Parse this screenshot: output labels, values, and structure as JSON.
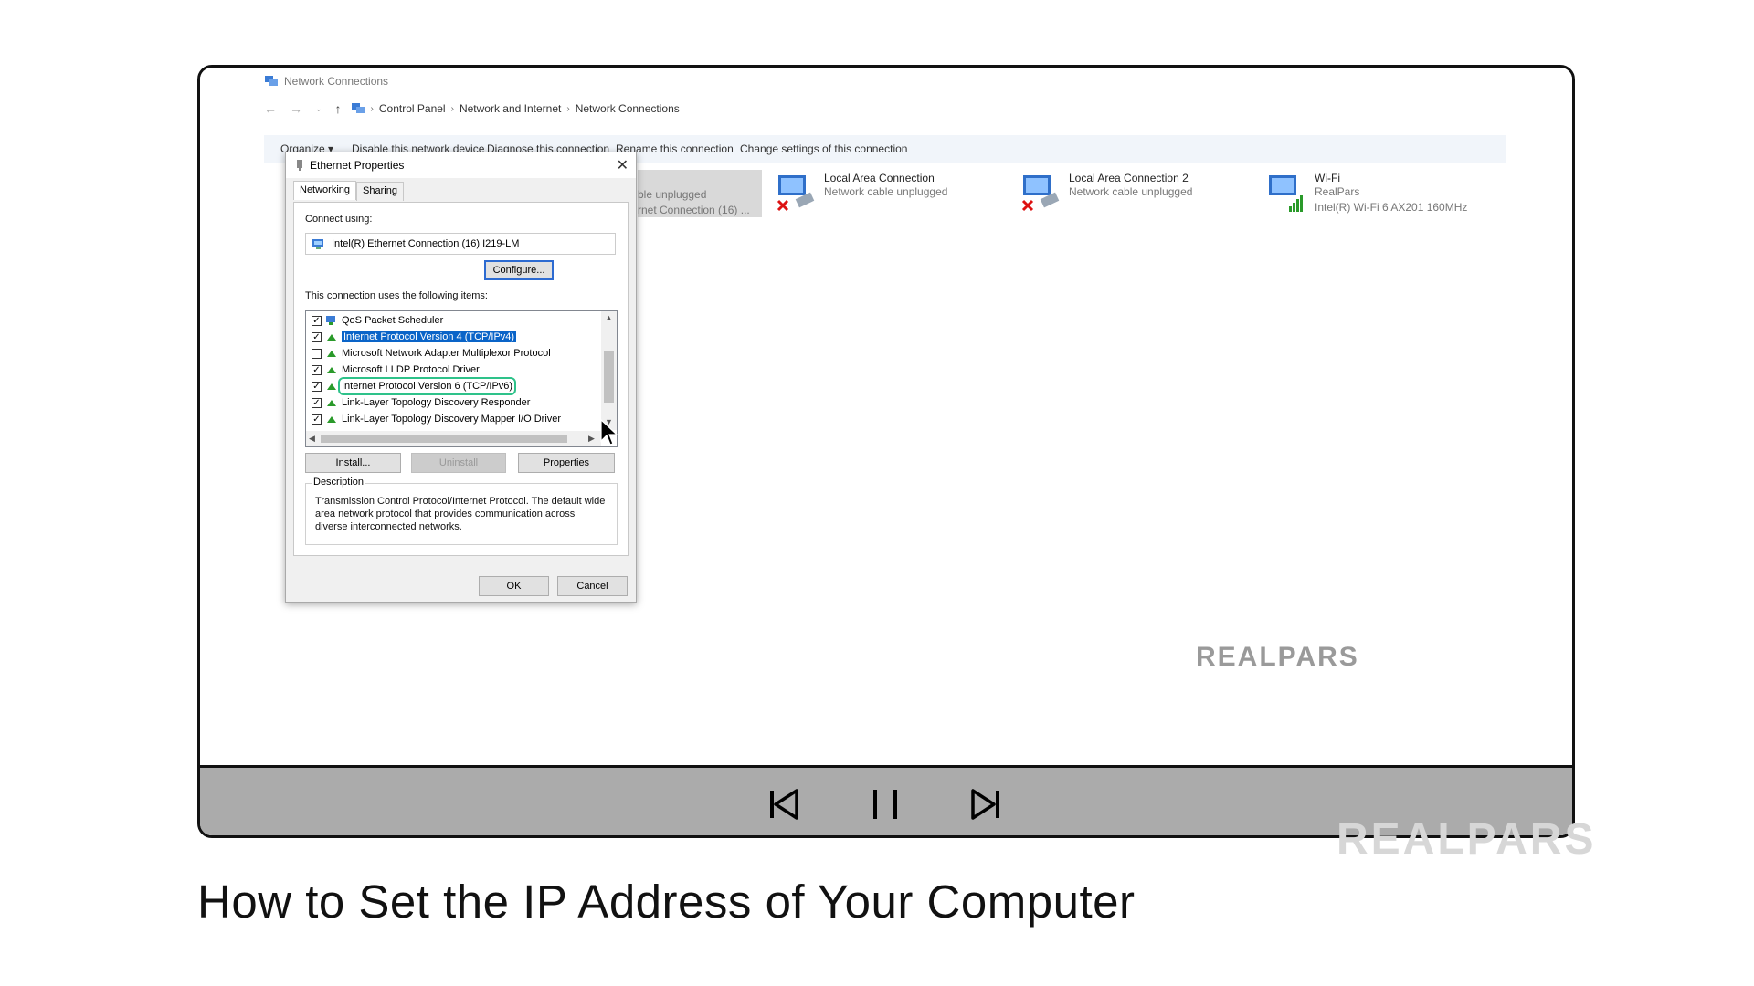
{
  "explorer": {
    "window_title": "Network Connections",
    "breadcrumb": [
      "Control Panel",
      "Network and Internet",
      "Network Connections"
    ],
    "commands": [
      "Organize ▾",
      "Disable this network device",
      "Diagnose this connection",
      "Rename this connection",
      "Change settings of this connection"
    ],
    "partial_connection": {
      "status": "ble unplugged",
      "device": "rnet Connection (16) ..."
    },
    "connections": [
      {
        "name": "Local Area Connection",
        "status": "Network cable unplugged",
        "device": ""
      },
      {
        "name": "Local Area Connection 2",
        "status": "Network cable unplugged",
        "device": ""
      },
      {
        "name": "Wi-Fi",
        "status": "RealPars",
        "device": "Intel(R) Wi-Fi 6 AX201 160MHz"
      }
    ]
  },
  "dialog": {
    "title": "Ethernet Properties",
    "tabs": [
      "Networking",
      "Sharing"
    ],
    "connect_using_label": "Connect using:",
    "adapter": "Intel(R) Ethernet Connection (16) I219-LM",
    "configure": "Configure...",
    "items_label": "This connection uses the following items:",
    "items": [
      {
        "label": "QoS Packet Scheduler",
        "checked": true
      },
      {
        "label": "Internet Protocol Version 4 (TCP/IPv4)",
        "checked": true
      },
      {
        "label": "Microsoft Network Adapter Multiplexor Protocol",
        "checked": false
      },
      {
        "label": "Microsoft LLDP Protocol Driver",
        "checked": true
      },
      {
        "label": "Internet Protocol Version 6 (TCP/IPv6)",
        "checked": true
      },
      {
        "label": "Link-Layer Topology Discovery Responder",
        "checked": true
      },
      {
        "label": "Link-Layer Topology Discovery Mapper I/O Driver",
        "checked": true
      }
    ],
    "install": "Install...",
    "uninstall": "Uninstall",
    "properties": "Properties",
    "description_label": "Description",
    "description": "Transmission Control Protocol/Internet Protocol. The default wide area network protocol that provides communication across diverse interconnected networks.",
    "ok": "OK",
    "cancel": "Cancel"
  },
  "watermark": "REALPARS",
  "caption": "How to Set the IP Address of Your Computer",
  "colors": {
    "selection": "#0a64c8",
    "highlight_outline": "#2ec28a",
    "control_bar": "#ababab"
  }
}
